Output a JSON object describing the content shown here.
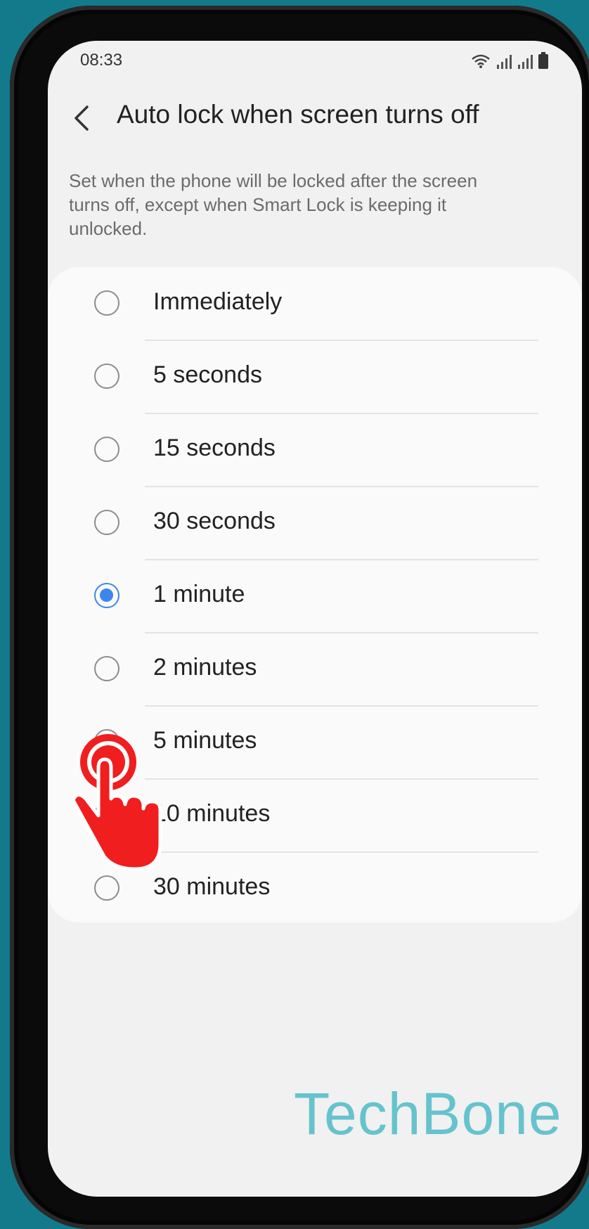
{
  "status_bar": {
    "time": "08:33",
    "icons": [
      "wifi-icon",
      "signal-icon",
      "signal-icon",
      "battery-icon"
    ]
  },
  "header": {
    "back_icon": "chevron-left-icon",
    "title": "Auto lock when screen turns off"
  },
  "description": "Set when the phone will be locked after the screen turns off, except when Smart Lock is keeping it unlocked.",
  "options": [
    {
      "label": "Immediately",
      "selected": false
    },
    {
      "label": "5 seconds",
      "selected": false
    },
    {
      "label": "15 seconds",
      "selected": false
    },
    {
      "label": "30 seconds",
      "selected": false
    },
    {
      "label": "1 minute",
      "selected": true
    },
    {
      "label": "2 minutes",
      "selected": false
    },
    {
      "label": "5 minutes",
      "selected": false
    },
    {
      "label": "10 minutes",
      "selected": false
    },
    {
      "label": "30 minutes",
      "selected": false
    }
  ],
  "watermark": "TechBone",
  "colors": {
    "background": "#137a8c",
    "accent": "#3e86ee",
    "tap_indicator": "#f01e1e",
    "watermark": "#66c3cd"
  }
}
